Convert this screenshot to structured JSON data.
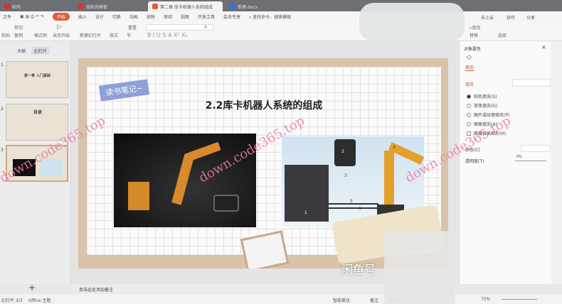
{
  "tabs": [
    {
      "label": "稻壳"
    },
    {
      "label": "找稻壳模板"
    },
    {
      "label": "第二章 库卡机器人系统组成"
    },
    {
      "label": "新建.docx"
    }
  ],
  "menu": {
    "file": "文件",
    "items": [
      "开始",
      "插入",
      "设计",
      "切换",
      "动画",
      "放映",
      "审阅",
      "视图",
      "开发工具",
      "会员专享"
    ],
    "search": "查找命令、搜索模板",
    "cloud": "未上云",
    "collab": "协作",
    "share": "分享"
  },
  "ribbon": {
    "paste": "粘贴",
    "cut": "剪切",
    "copy": "复制",
    "format_painter": "格式刷",
    "play": "当页开始",
    "new_slide": "新建幻灯片",
    "layout": "版式",
    "section": "节",
    "reset": "重置",
    "font_size": "0",
    "find": "查找",
    "replace": "替换",
    "select": "选择"
  },
  "left_panel": {
    "tab_outline": "大纲",
    "tab_slides": "幻灯片",
    "slides": [
      {
        "num": "1",
        "title": "第一章 入门基础"
      },
      {
        "num": "2",
        "title": "目录"
      },
      {
        "num": "3",
        "title": ""
      }
    ],
    "add": "+"
  },
  "slide": {
    "badge": "读书笔记~",
    "title": "2.2库卡机器人系统的组成",
    "labels": [
      "1",
      "2",
      "3",
      "4",
      "5",
      "6"
    ]
  },
  "right_panel": {
    "title": "对象属性",
    "fill_tab": "填充",
    "fill_section": "填充",
    "options": [
      "纯色填充(S)",
      "渐变填充(G)",
      "图片或纹理填充(P)",
      "图案填充(A)"
    ],
    "hide_bg": "隐藏背景图形(H)",
    "color": "颜色(C)",
    "transparency": "透明度(T)",
    "transparency_value": "0%"
  },
  "notes": "单击此处添加备注",
  "status": {
    "slide": "幻灯片 3/3",
    "theme": "Office 主题",
    "beautify": "智能美化",
    "notes": "备注",
    "comments": "批注",
    "zoom": "75%"
  },
  "watermarks": [
    "down.code365.top",
    "闲鱼号"
  ]
}
